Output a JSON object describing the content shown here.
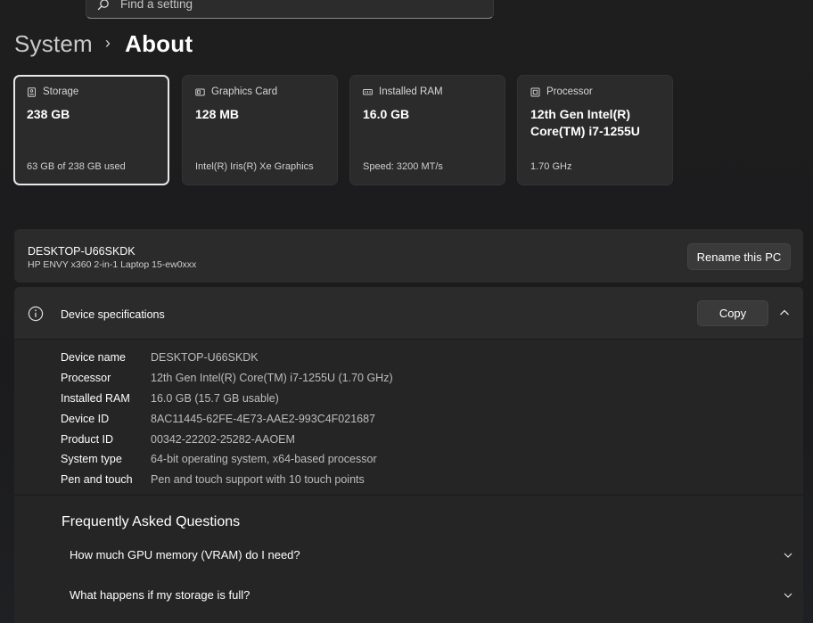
{
  "search": {
    "placeholder": "Find a setting"
  },
  "breadcrumb": {
    "parent": "System",
    "separator": "›",
    "current": "About"
  },
  "cards": [
    {
      "title": "Storage",
      "value": "238 GB",
      "sub": "63 GB of 238 GB used",
      "icon": "storage-icon"
    },
    {
      "title": "Graphics Card",
      "value": "128 MB",
      "sub": "Intel(R) Iris(R) Xe Graphics",
      "icon": "graphics-card-icon"
    },
    {
      "title": "Installed RAM",
      "value": "16.0 GB",
      "sub": "Speed: 3200 MT/s",
      "icon": "ram-icon"
    },
    {
      "title": "Processor",
      "value": "12th Gen Intel(R) Core(TM) i7-1255U",
      "sub": "1.70 GHz",
      "icon": "processor-icon"
    }
  ],
  "pc": {
    "name": "DESKTOP-U66SKDK",
    "model": "HP ENVY x360 2-in-1 Laptop 15-ew0xxx",
    "rename_label": "Rename this PC"
  },
  "specs": {
    "title": "Device specifications",
    "copy_label": "Copy",
    "rows": [
      {
        "key": "Device name",
        "value": "DESKTOP-U66SKDK"
      },
      {
        "key": "Processor",
        "value": "12th Gen Intel(R) Core(TM) i7-1255U (1.70 GHz)"
      },
      {
        "key": "Installed RAM",
        "value": "16.0 GB (15.7 GB usable)"
      },
      {
        "key": "Device ID",
        "value": "8AC11445-62FE-4E73-AAE2-993C4F021687"
      },
      {
        "key": "Product ID",
        "value": "00342-22202-25282-AAOEM"
      },
      {
        "key": "System type",
        "value": "64-bit operating system, x64-based processor"
      },
      {
        "key": "Pen and touch",
        "value": "Pen and touch support with 10 touch points"
      }
    ]
  },
  "faq": {
    "title": "Frequently Asked Questions",
    "items": [
      {
        "question": "How much GPU memory (VRAM) do I need?"
      },
      {
        "question": "What happens if my storage is full?"
      }
    ]
  }
}
